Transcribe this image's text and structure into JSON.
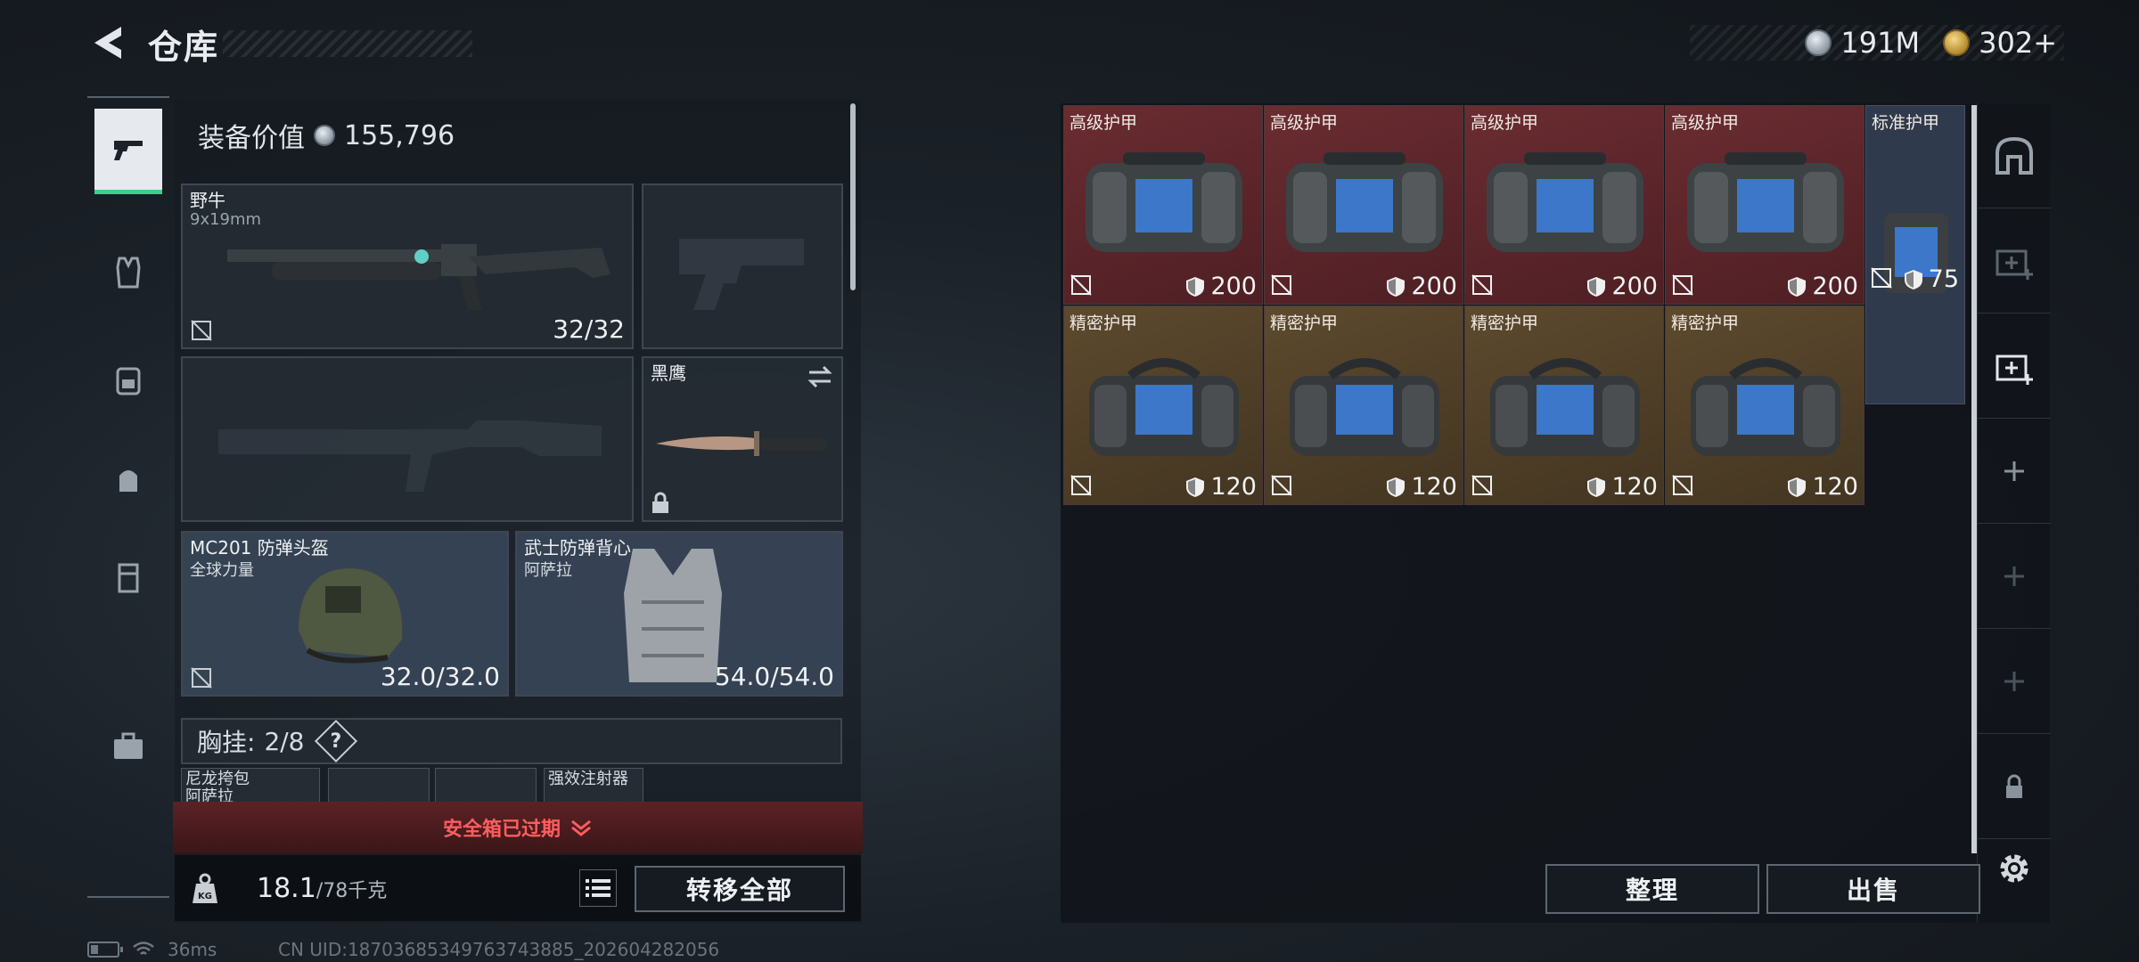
{
  "header": {
    "title": "仓库"
  },
  "currency": [
    {
      "icon": "silver-coin-icon",
      "amount": "191M"
    },
    {
      "icon": "gold-coin-icon",
      "amount": "302+"
    }
  ],
  "loadout": {
    "value_label": "装备价值",
    "value": "155,796",
    "primary": {
      "name": "野牛",
      "caliber": "9x19mm",
      "ammo": "32/32"
    },
    "knife": {
      "name": "黑鹰"
    },
    "helmet": {
      "name": "MC201 防弹头盔",
      "brand": "全球力量",
      "durability": "32.0/32.0"
    },
    "armor": {
      "name": "武士防弹背心",
      "brand": "阿萨拉",
      "durability": "54.0/54.0"
    },
    "chest_rig": {
      "label": "胸挂:",
      "count": "2/8",
      "help": "?"
    },
    "chest_items": [
      {
        "name": "尼龙挎包",
        "sub": "阿萨拉"
      },
      {
        "name": ""
      },
      {
        "name": ""
      },
      {
        "name": "强效注射器"
      }
    ],
    "safebox_status": "安全箱已过期",
    "weight": "18.1",
    "weight_max": "/78千克",
    "transfer_all": "转移全部"
  },
  "storage": {
    "row1": [
      {
        "label": "高级护甲",
        "durability": "200",
        "tier": "red"
      },
      {
        "label": "高级护甲",
        "durability": "200",
        "tier": "red"
      },
      {
        "label": "高级护甲",
        "durability": "200",
        "tier": "red"
      },
      {
        "label": "高级护甲",
        "durability": "200",
        "tier": "red"
      }
    ],
    "row2": [
      {
        "label": "精密护甲",
        "durability": "120",
        "tier": "gold"
      },
      {
        "label": "精密护甲",
        "durability": "120",
        "tier": "gold"
      },
      {
        "label": "精密护甲",
        "durability": "120",
        "tier": "gold"
      },
      {
        "label": "精密护甲",
        "durability": "120",
        "tier": "gold"
      }
    ],
    "standard": {
      "label": "标准护甲",
      "durability": "75",
      "tier": "blue"
    },
    "sort_label": "整理",
    "sell_label": "出售"
  },
  "status": {
    "ping": "36ms",
    "uid": "CN UID:18703685349763743885_202604282056"
  }
}
